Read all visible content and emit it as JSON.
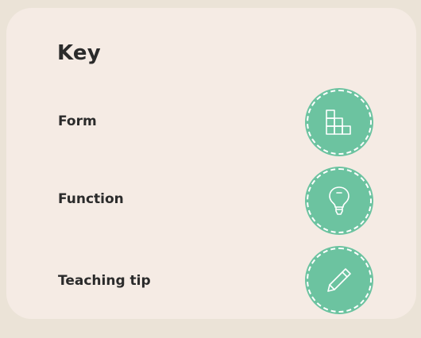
{
  "key": {
    "title": "Key",
    "items": [
      {
        "label": "Form",
        "icon": "stacked-blocks-icon"
      },
      {
        "label": "Function",
        "icon": "lightbulb-icon"
      },
      {
        "label": "Teaching tip",
        "icon": "pencil-icon"
      }
    ]
  },
  "colors": {
    "background": "#ebe3d7",
    "card": "#f5ebe4",
    "badge": "#6cc3a0",
    "icon_stroke": "#ffffff",
    "text": "#2b2b2b"
  }
}
